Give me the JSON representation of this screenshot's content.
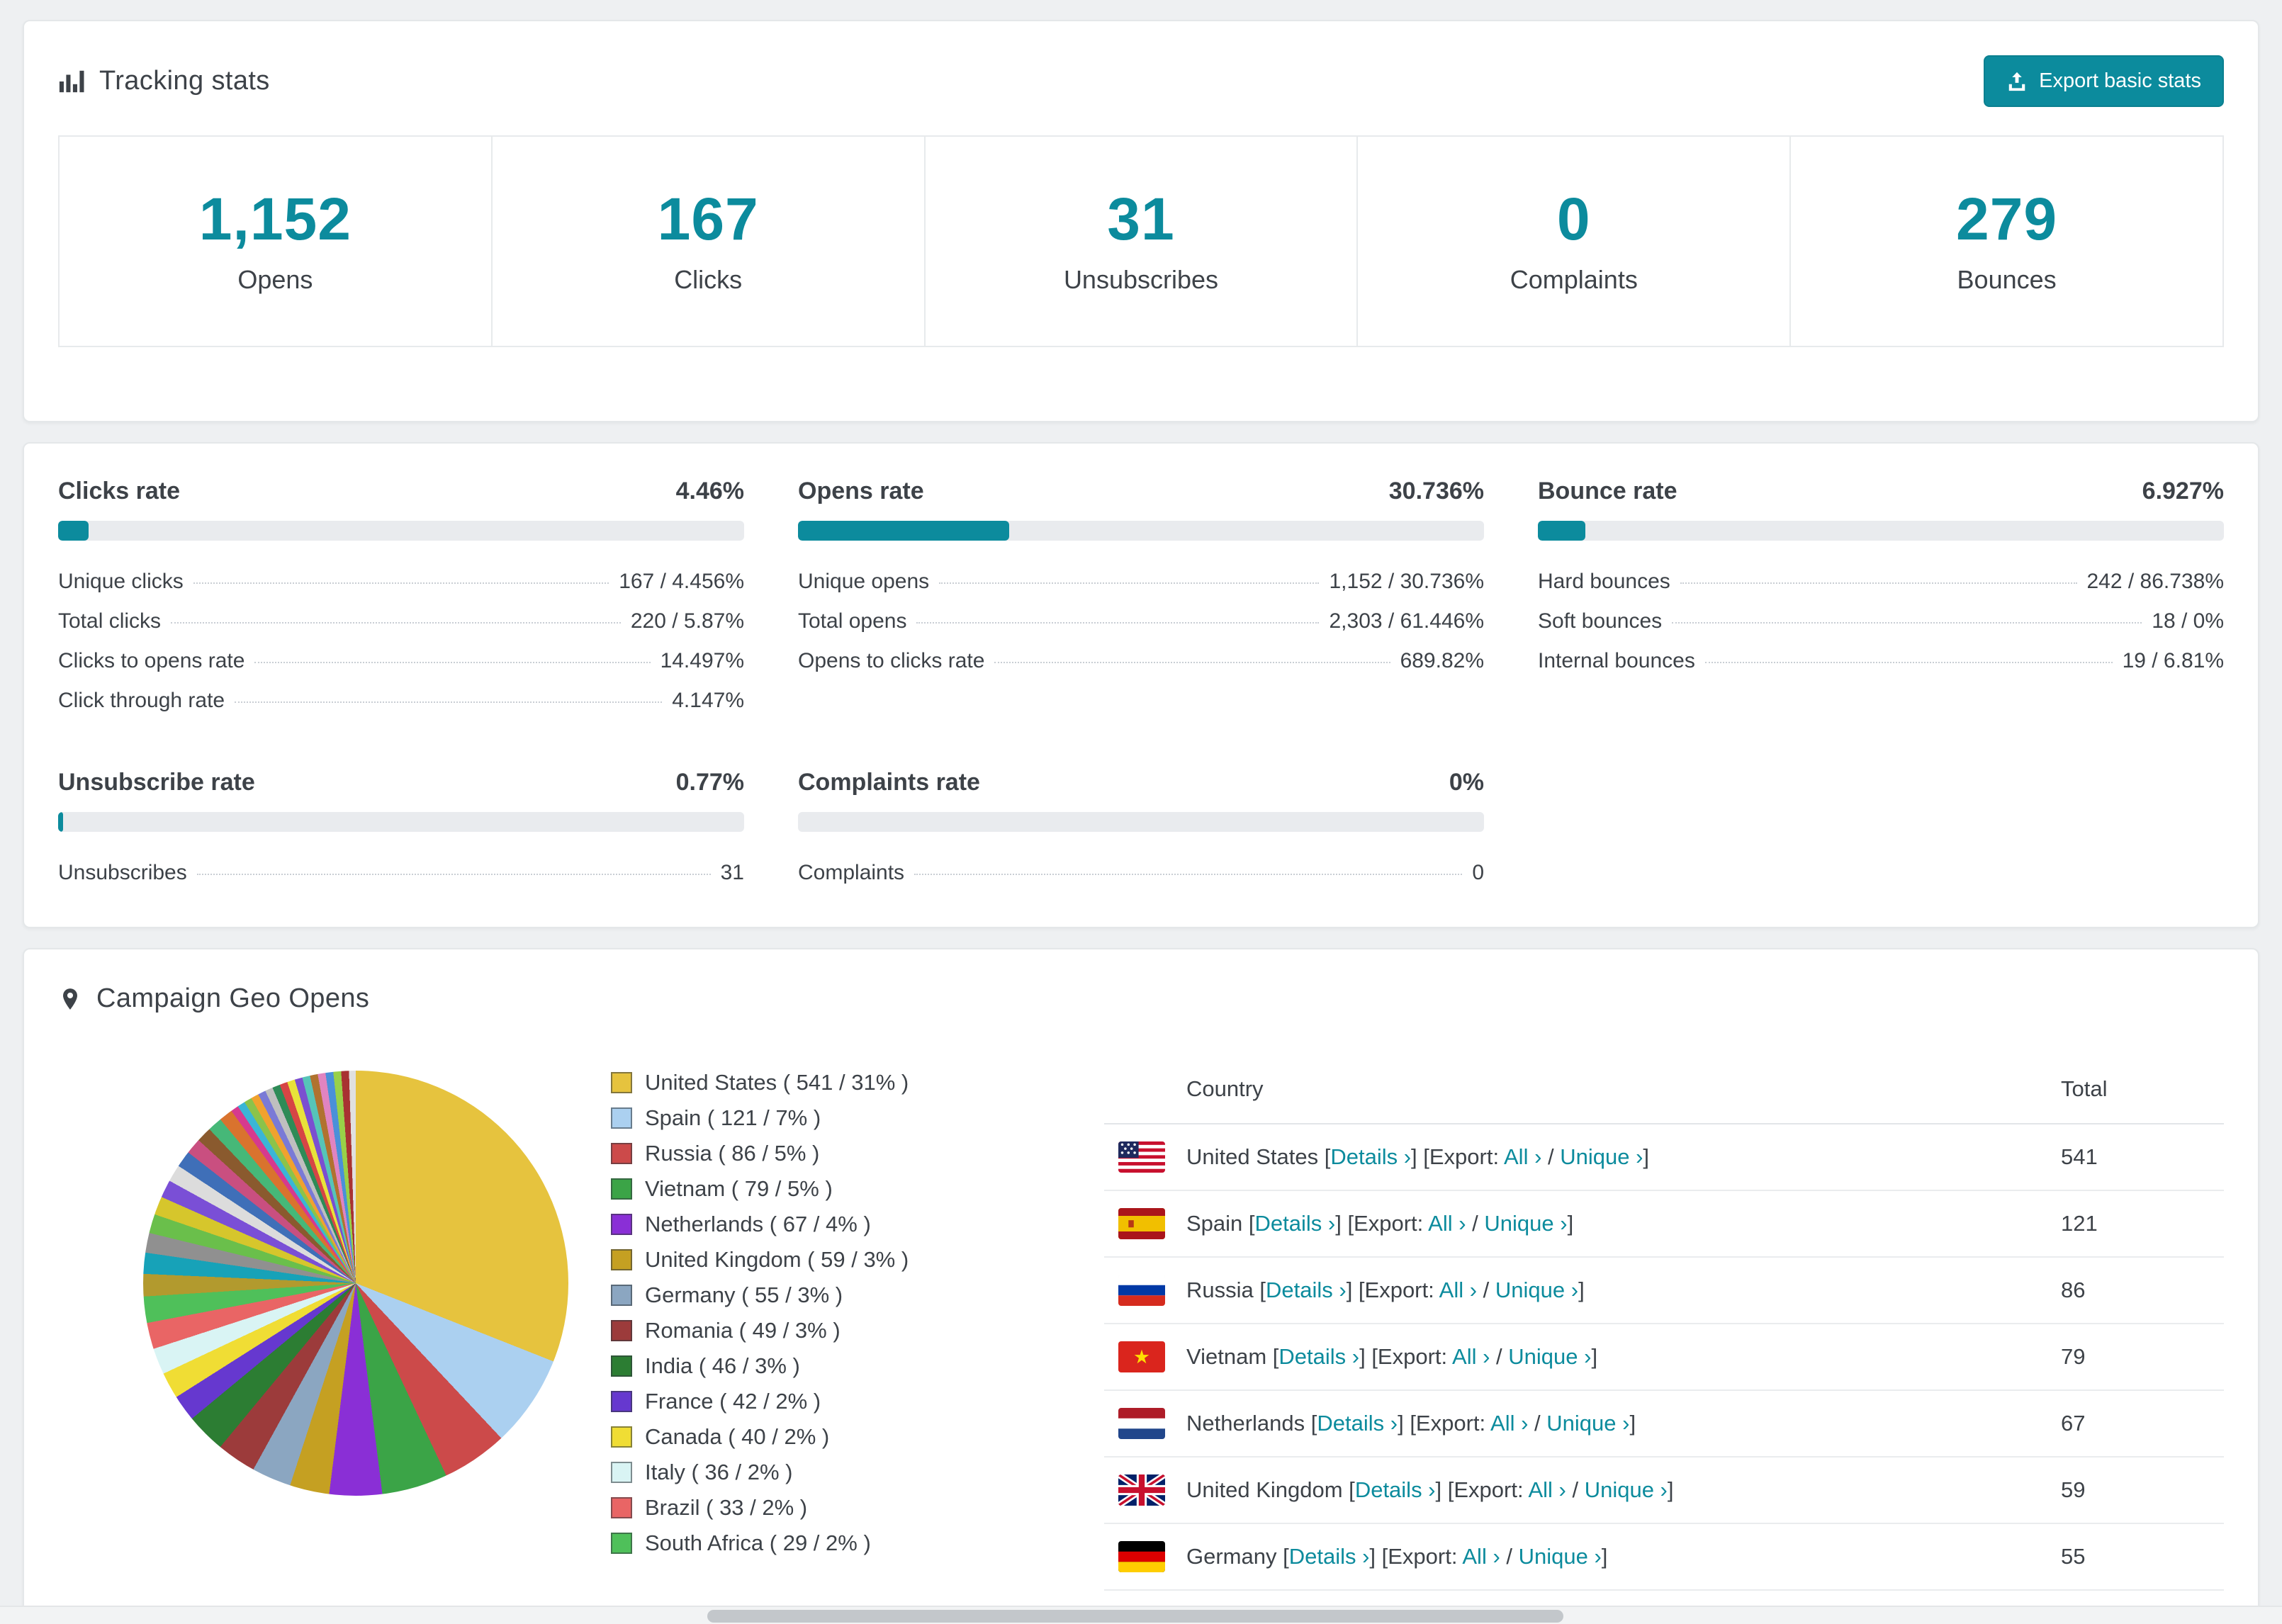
{
  "colors": {
    "accent": "#0c8b9d"
  },
  "tracking": {
    "title": "Tracking stats",
    "export_button": "Export basic stats"
  },
  "stats": [
    {
      "value": "1,152",
      "label": "Opens"
    },
    {
      "value": "167",
      "label": "Clicks"
    },
    {
      "value": "31",
      "label": "Unsubscribes"
    },
    {
      "value": "0",
      "label": "Complaints"
    },
    {
      "value": "279",
      "label": "Bounces"
    }
  ],
  "rates": [
    {
      "title": "Clicks rate",
      "value": "4.46%",
      "percent": 4.46,
      "rows": [
        {
          "label": "Unique clicks",
          "value": "167 / 4.456%"
        },
        {
          "label": "Total clicks",
          "value": "220 / 5.87%"
        },
        {
          "label": "Clicks to opens rate",
          "value": "14.497%"
        },
        {
          "label": "Click through rate",
          "value": "4.147%"
        }
      ]
    },
    {
      "title": "Opens rate",
      "value": "30.736%",
      "percent": 30.736,
      "rows": [
        {
          "label": "Unique opens",
          "value": "1,152 / 30.736%"
        },
        {
          "label": "Total opens",
          "value": "2,303 / 61.446%"
        },
        {
          "label": "Opens to clicks rate",
          "value": "689.82%"
        }
      ]
    },
    {
      "title": "Bounce rate",
      "value": "6.927%",
      "percent": 6.927,
      "rows": [
        {
          "label": "Hard bounces",
          "value": "242 / 86.738%"
        },
        {
          "label": "Soft bounces",
          "value": "18 / 0%"
        },
        {
          "label": "Internal bounces",
          "value": "19 / 6.81%"
        }
      ]
    },
    {
      "title": "Unsubscribe rate",
      "value": "0.77%",
      "percent": 0.77,
      "rows": [
        {
          "label": "Unsubscribes",
          "value": "31"
        }
      ]
    },
    {
      "title": "Complaints rate",
      "value": "0%",
      "percent": 0,
      "rows": [
        {
          "label": "Complaints",
          "value": "0"
        }
      ]
    }
  ],
  "geo": {
    "title": "Campaign Geo Opens",
    "legend": [
      {
        "label": "United States ( 541 / 31% )",
        "color": "#e6c33e"
      },
      {
        "label": "Spain ( 121 / 7% )",
        "color": "#abd0f0"
      },
      {
        "label": "Russia ( 86 / 5% )",
        "color": "#cc4a4a"
      },
      {
        "label": "Vietnam ( 79 / 5% )",
        "color": "#3ba447"
      },
      {
        "label": "Netherlands ( 67 / 4% )",
        "color": "#8a2fd6"
      },
      {
        "label": "United Kingdom ( 59 / 3% )",
        "color": "#c5a022"
      },
      {
        "label": "Germany ( 55 / 3% )",
        "color": "#8ba6c1"
      },
      {
        "label": "Romania ( 49 / 3% )",
        "color": "#9c3b3b"
      },
      {
        "label": "India ( 46 / 3% )",
        "color": "#2c7d33"
      },
      {
        "label": "France ( 42 / 2% )",
        "color": "#6638cf"
      },
      {
        "label": "Canada ( 40 / 2% )",
        "color": "#f0dd34"
      },
      {
        "label": "Italy ( 36 / 2% )",
        "color": "#d9f4f4"
      },
      {
        "label": "Brazil ( 33 / 2% )",
        "color": "#e96565"
      },
      {
        "label": "South Africa ( 29 / 2% )",
        "color": "#4fc05a"
      }
    ],
    "table": {
      "headers": [
        "Country",
        "Total"
      ],
      "links": {
        "details": "Details",
        "export": "Export:",
        "all": "All",
        "unique": "Unique",
        "chev": "›"
      },
      "rows": [
        {
          "flag": "us",
          "country": "United States",
          "total": "541"
        },
        {
          "flag": "es",
          "country": "Spain",
          "total": "121"
        },
        {
          "flag": "ru",
          "country": "Russia",
          "total": "86"
        },
        {
          "flag": "vn",
          "country": "Vietnam",
          "total": "79"
        },
        {
          "flag": "nl",
          "country": "Netherlands",
          "total": "67"
        },
        {
          "flag": "gb",
          "country": "United Kingdom",
          "total": "59"
        },
        {
          "flag": "de",
          "country": "Germany",
          "total": "55"
        }
      ]
    }
  },
  "chart_data": {
    "type": "pie",
    "title": "Campaign Geo Opens",
    "labels": [
      "United States",
      "Spain",
      "Russia",
      "Vietnam",
      "Netherlands",
      "United Kingdom",
      "Germany",
      "Romania",
      "India",
      "France",
      "Canada",
      "Italy",
      "Brazil",
      "South Africa"
    ],
    "values": [
      541,
      121,
      86,
      79,
      67,
      59,
      55,
      49,
      46,
      42,
      40,
      36,
      33,
      29
    ],
    "percents": [
      31,
      7,
      5,
      5,
      4,
      3,
      3,
      3,
      3,
      2,
      2,
      2,
      2,
      2
    ],
    "slices": [
      {
        "c": "#e6c33e",
        "p": 31
      },
      {
        "c": "#abd0f0",
        "p": 7
      },
      {
        "c": "#cc4a4a",
        "p": 5
      },
      {
        "c": "#3ba447",
        "p": 5
      },
      {
        "c": "#8a2fd6",
        "p": 4
      },
      {
        "c": "#c5a022",
        "p": 3
      },
      {
        "c": "#8ba6c1",
        "p": 3
      },
      {
        "c": "#9c3b3b",
        "p": 3
      },
      {
        "c": "#2c7d33",
        "p": 3
      },
      {
        "c": "#6638cf",
        "p": 2
      },
      {
        "c": "#f0dd34",
        "p": 2
      },
      {
        "c": "#d9f4f4",
        "p": 2
      },
      {
        "c": "#e96565",
        "p": 2
      },
      {
        "c": "#4fc05a",
        "p": 2
      },
      {
        "c": "#b29a2e",
        "p": 1.7
      },
      {
        "c": "#17a2b8",
        "p": 1.6
      },
      {
        "c": "#909090",
        "p": 1.5
      },
      {
        "c": "#6abf4b",
        "p": 1.45
      },
      {
        "c": "#d6c62c",
        "p": 1.4
      },
      {
        "c": "#7a4fd6",
        "p": 1.35
      },
      {
        "c": "#dcdcdc",
        "p": 1.3
      },
      {
        "c": "#3f6fb8",
        "p": 1.25
      },
      {
        "c": "#c94f80",
        "p": 1.2
      },
      {
        "c": "#8a5a2e",
        "p": 1.15
      },
      {
        "c": "#46b878",
        "p": 1.1
      },
      {
        "c": "#d9732e",
        "p": 1.05
      },
      {
        "c": "#d63a8e",
        "p": 0.59
      },
      {
        "c": "#3ab5d6",
        "p": 0.59
      },
      {
        "c": "#8bc34a",
        "p": 0.59
      },
      {
        "c": "#f0a22e",
        "p": 0.59
      },
      {
        "c": "#7a7ad6",
        "p": 0.59
      },
      {
        "c": "#bfbfbf",
        "p": 0.59
      },
      {
        "c": "#2e8b57",
        "p": 0.59
      },
      {
        "c": "#d64545",
        "p": 0.59
      },
      {
        "c": "#e8e23a",
        "p": 0.59
      },
      {
        "c": "#7b4fd0",
        "p": 0.59
      },
      {
        "c": "#56c4b8",
        "p": 0.59
      },
      {
        "c": "#b0722f",
        "p": 0.59
      },
      {
        "c": "#e084c0",
        "p": 0.59
      },
      {
        "c": "#4a90d9",
        "p": 0.59
      },
      {
        "c": "#98d048",
        "p": 0.59
      },
      {
        "c": "#a83232",
        "p": 0.59
      },
      {
        "c": "#e0e0e0",
        "p": 0.59
      },
      {
        "c": "#35869c",
        "p": 0.59
      },
      {
        "c": "#c9b13a",
        "p": 0.59
      },
      {
        "c": "#6a4fa0",
        "p": 0.59
      },
      {
        "c": "#49c46a",
        "p": 0.59
      },
      {
        "c": "#e06a3a",
        "p": 0.59
      },
      {
        "c": "#8899aa",
        "p": 0.59
      },
      {
        "c": "#d43a5e",
        "p": 0.59
      },
      {
        "c": "#b9a0e8",
        "p": 0.59
      },
      {
        "c": "#2f6d4f",
        "p": 0.59
      },
      {
        "c": "#e8c88a",
        "p": 0.59
      },
      {
        "c": "#5a5ad0",
        "p": 0.59
      },
      {
        "c": "#9fd0e8",
        "p": 0.59
      },
      {
        "c": "#c42fb0",
        "p": 0.59
      },
      {
        "c": "#6f6f6f",
        "p": 0.59
      },
      {
        "c": "#58d058",
        "p": 0.59
      },
      {
        "c": "#d98a3a",
        "p": 0.59
      },
      {
        "c": "#4a4ad9",
        "p": 0.59
      }
    ]
  }
}
